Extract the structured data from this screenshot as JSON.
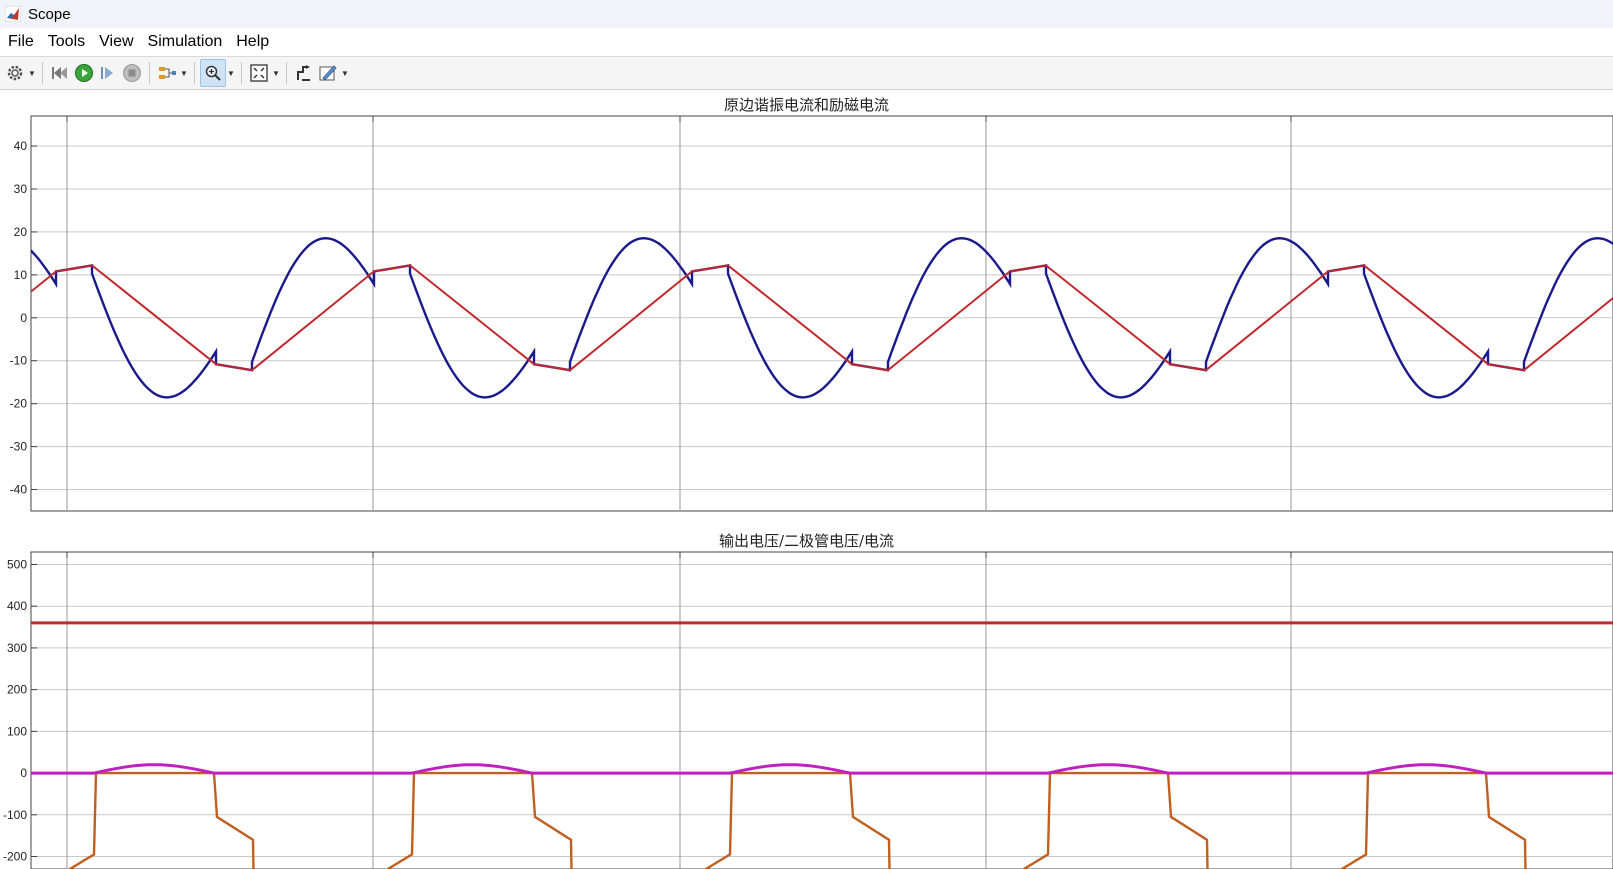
{
  "window": {
    "title": "Scope"
  },
  "menu": [
    "File",
    "Tools",
    "View",
    "Simulation",
    "Help"
  ],
  "toolbar": {
    "icons": [
      "gear-icon",
      "step-back-icon",
      "run-icon",
      "step-forward-icon",
      "stop-icon",
      "signal-selector-icon",
      "zoom-in-icon",
      "fit-to-view-icon",
      "restore-icon",
      "measure-icon"
    ]
  },
  "colors": {
    "blue": "#1a1a8c",
    "red": "#c0282d",
    "dark_red": "#a01c1c",
    "magenta": "#c020c0",
    "orange": "#c06020"
  },
  "plots": [
    {
      "title": "原边谐振电流和励磁电流",
      "yticks": [
        "40",
        "30",
        "20",
        "10",
        "0",
        "-10",
        "-20",
        "-30",
        "-40"
      ]
    },
    {
      "title": "输出电压/二极管电压/电流",
      "yticks": [
        "500",
        "400",
        "300",
        "200",
        "100",
        "0",
        "-100",
        "-200"
      ]
    }
  ],
  "chart_data": [
    {
      "type": "line",
      "title": "原边谐振电流和励磁电流",
      "ylim": [
        -45,
        47
      ],
      "yticks": [
        40,
        30,
        20,
        10,
        0,
        -10,
        -20,
        -30,
        -40
      ],
      "grid": true,
      "series": [
        {
          "color": "#1a1a8c",
          "description": "sinusoidal resonant current, amplitude ~20, period ~5.2 units, flat segments at ±11"
        },
        {
          "color": "#c0282d",
          "description": "triangular magnetizing current between -12 and +12"
        }
      ]
    },
    {
      "type": "line",
      "title": "输出电压/二极管电压/电流",
      "ylim": [
        -230,
        530
      ],
      "yticks": [
        500,
        400,
        300,
        200,
        100,
        0,
        -100,
        -200
      ],
      "grid": true,
      "series": [
        {
          "color": "#c0282d",
          "values_note": "constant",
          "y": 360
        },
        {
          "color": "#c020c0",
          "description": "near zero with small positive bumps ~20"
        },
        {
          "color": "#c06020",
          "description": "pulses between 0 and about -250"
        }
      ]
    }
  ]
}
